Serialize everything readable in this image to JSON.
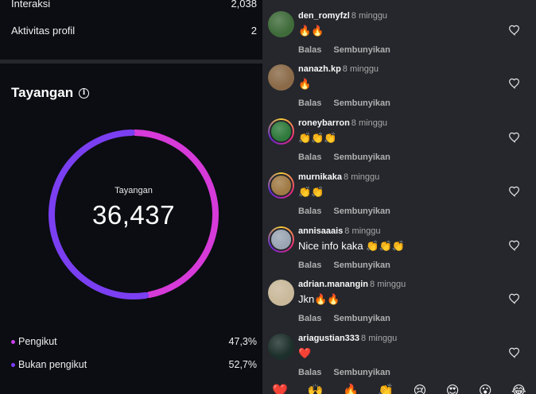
{
  "stats": {
    "interactions": {
      "label": "Interaksi",
      "value": "2,038"
    },
    "profile_activity": {
      "label": "Aktivitas profil",
      "value": "2"
    }
  },
  "views": {
    "title": "Tayangan",
    "info_icon": "info-icon",
    "center_label": "Tayangan",
    "total": "36,437",
    "legend": [
      {
        "label": "Pengikut",
        "percent": "47,3%",
        "color": "#c840e9"
      },
      {
        "label": "Bukan pengikut",
        "percent": "52,7%",
        "color": "#7d3cf8"
      }
    ]
  },
  "chart_data": {
    "type": "pie",
    "title": "Tayangan",
    "categories": [
      "Pengikut",
      "Bukan pengikut"
    ],
    "values": [
      47.3,
      52.7
    ],
    "colors": [
      "#d63ad9",
      "#7b3ff2"
    ]
  },
  "comments": [
    {
      "user": "den_romyfzl",
      "time": "8 minggu",
      "text": "🔥🔥",
      "avatar_color": "#3f6b3a",
      "ring": false
    },
    {
      "user": "nanazh.kp",
      "time": "8 minggu",
      "text": "🔥",
      "avatar_color": "#8a6a48",
      "ring": false
    },
    {
      "user": "roneybarron",
      "time": "8 minggu",
      "text": "👏👏👏",
      "avatar_color": "#2f7a3c",
      "ring": true
    },
    {
      "user": "murnikaka",
      "time": "8 minggu",
      "text": "👏👏",
      "avatar_color": "#a07a45",
      "ring": true
    },
    {
      "user": "annisaaais",
      "time": "8 minggu",
      "text": "Nice info kaka 👏👏👏",
      "avatar_color": "#9aa4b3",
      "ring": true
    },
    {
      "user": "adrian.manangin",
      "time": "8 minggu",
      "text": "Jkn🔥🔥",
      "avatar_color": "#c9b89a",
      "ring": false
    },
    {
      "user": "ariagustian333",
      "time": "8 minggu",
      "text": "❤️",
      "avatar_color": "#1d2f2a",
      "ring": false
    }
  ],
  "comment_actions": {
    "reply": "Balas",
    "hide": "Sembunyikan"
  },
  "emoji_bar": [
    "❤️",
    "🙌",
    "🔥",
    "👏",
    "😢",
    "😍",
    "😮",
    "😂"
  ]
}
